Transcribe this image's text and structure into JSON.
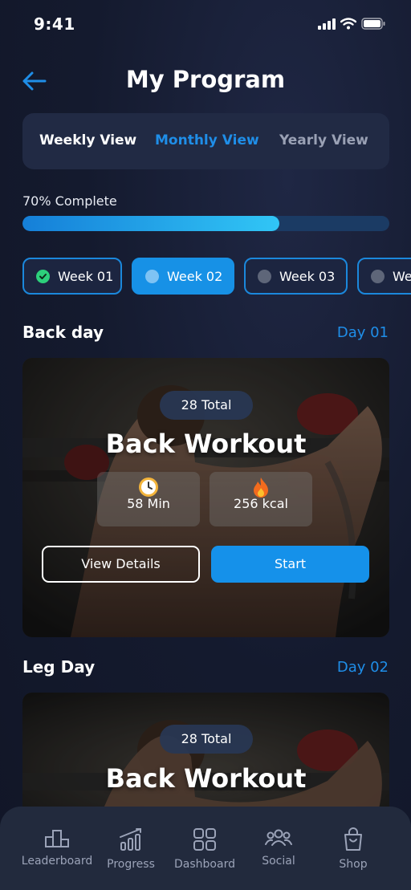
{
  "status": {
    "time": "9:41"
  },
  "header": {
    "title": "My Program"
  },
  "view_switch": {
    "tabs": [
      "Weekly View",
      "Monthly View",
      "Yearly View"
    ],
    "selected": "Monthly View"
  },
  "progress": {
    "label": "70% Complete",
    "value": 0.7
  },
  "weeks": [
    {
      "label": "Week 01",
      "state": "done"
    },
    {
      "label": "Week 02",
      "state": "current"
    },
    {
      "label": "Week 03",
      "state": "upcoming"
    },
    {
      "label": "We",
      "state": "upcoming"
    }
  ],
  "sections": [
    {
      "title": "Back day",
      "day": "Day 01",
      "card": {
        "total": "28 Total",
        "title": "Back Workout",
        "duration": "58 Min",
        "calories": "256 kcal",
        "details_label": "View Details",
        "start_label": "Start"
      }
    },
    {
      "title": "Leg Day",
      "day": "Day 02",
      "card": {
        "total": "28 Total",
        "title": "Back Workout"
      }
    }
  ],
  "tabbar": {
    "items": [
      "Leaderboard",
      "Progress",
      "Dashboard",
      "Social",
      "Shop"
    ]
  },
  "colors": {
    "accent": "#1791e6",
    "success": "#2dd07b",
    "background": "#141a2e"
  },
  "icons": {
    "back": "arrow-left-icon",
    "check": "check-icon",
    "clock": "clock-icon",
    "fire": "fire-icon"
  }
}
